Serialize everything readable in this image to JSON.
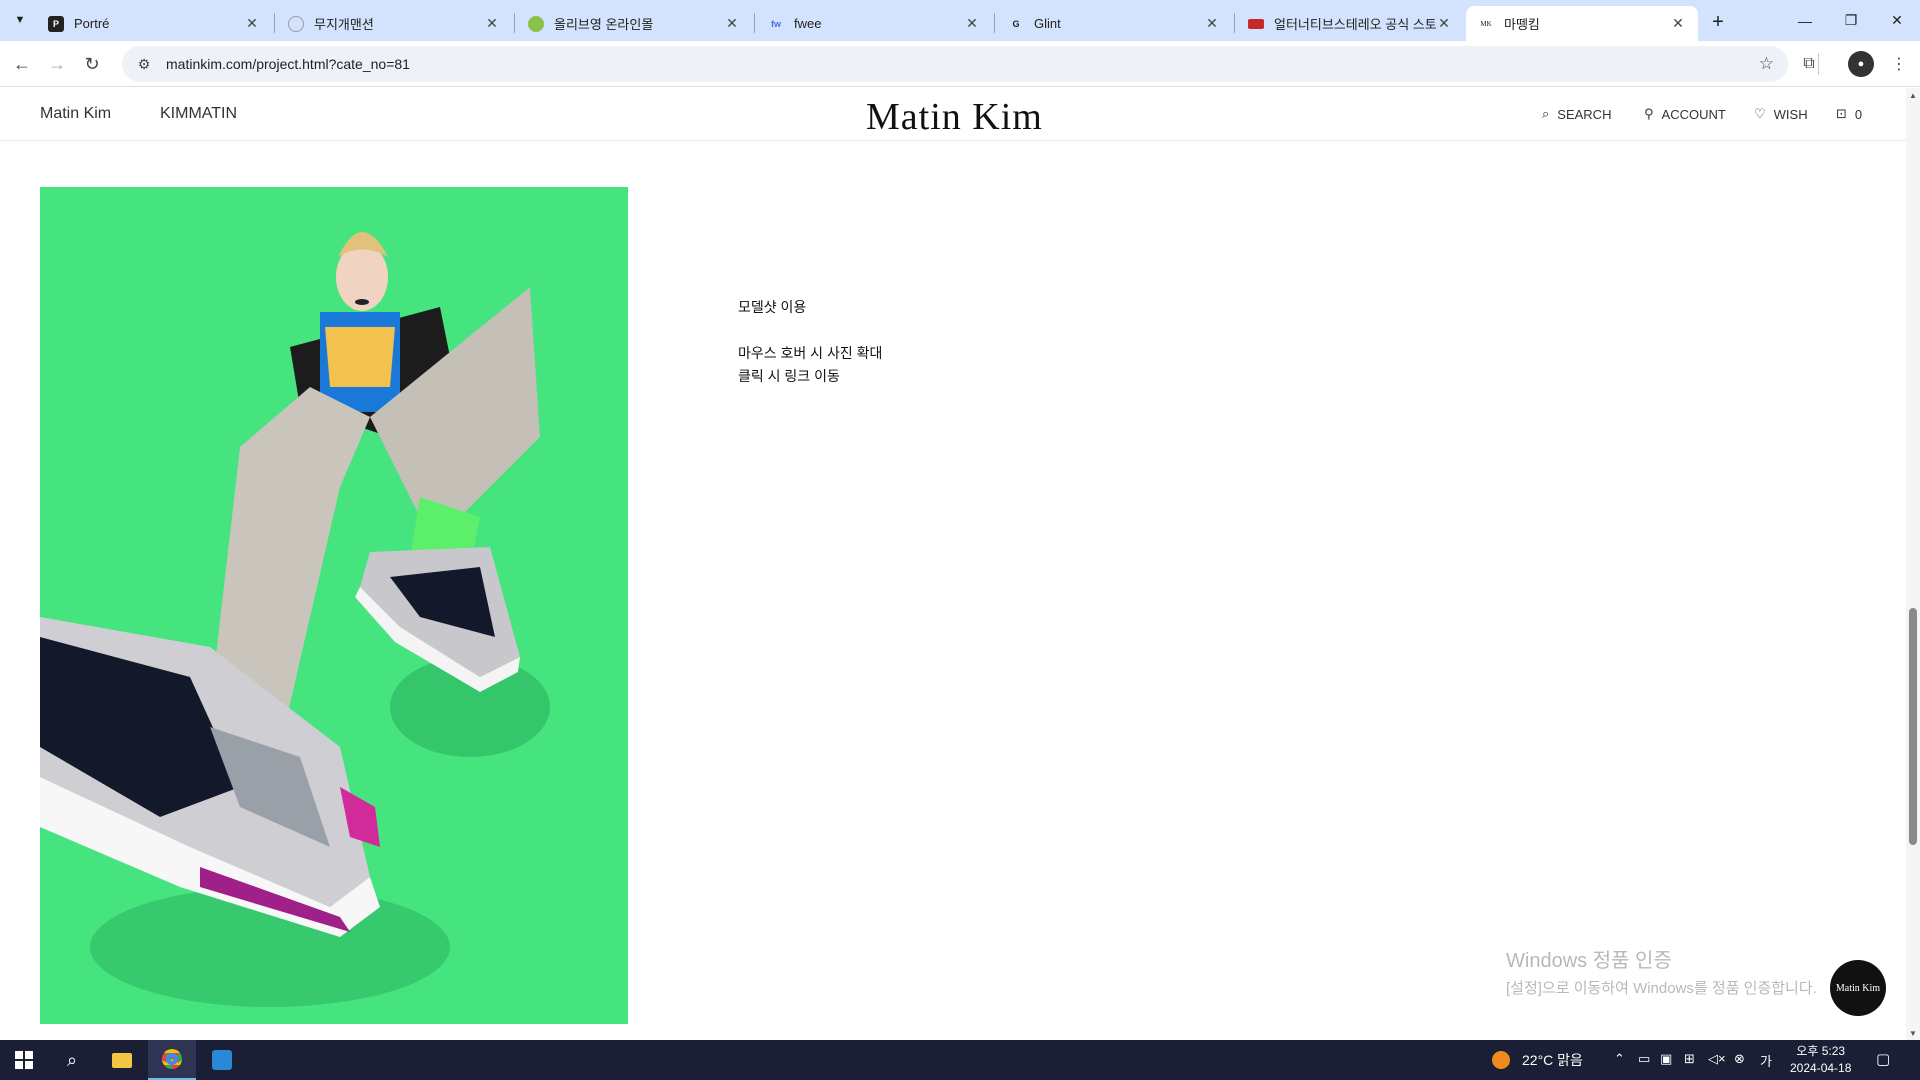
{
  "browser": {
    "tabs": [
      {
        "title": "Portré",
        "favicon": "P",
        "favicon_color": "#222222",
        "active": false
      },
      {
        "title": "무지개맨션",
        "favicon": "○",
        "favicon_color": "#9aa0a6",
        "active": false
      },
      {
        "title": "올리브영 온라인몰",
        "favicon": "O",
        "favicon_color": "#8bc34a",
        "active": false
      },
      {
        "title": "fwee",
        "favicon": "fw",
        "favicon_color": "#4a6ee0",
        "active": false
      },
      {
        "title": "Glint",
        "favicon": "G",
        "favicon_color": "#222222",
        "active": false
      },
      {
        "title": "얼터너티브스테레오 공식 스토",
        "favicon": "▬",
        "favicon_color": "#c62828",
        "active": false
      },
      {
        "title": "마뗑킴",
        "favicon": "MK",
        "favicon_color": "#222222",
        "active": true
      }
    ],
    "url": "matinkim.com/project.html?cate_no=81"
  },
  "site": {
    "nav_left": [
      "Matin Kim",
      "KIMMATIN"
    ],
    "logo": "Matin Kim",
    "nav_right": [
      {
        "label": "SEARCH",
        "icon": "search-icon"
      },
      {
        "label": "ACCOUNT",
        "icon": "account-icon"
      },
      {
        "label": "WISH",
        "icon": "heart-icon"
      },
      {
        "label": "0",
        "icon": "bag-icon"
      }
    ],
    "description": [
      "모델샷 이용",
      "",
      "마우스 호버 시 사진 확대",
      "클릭 시 링크 이동"
    ],
    "float_badge": "Matin Kim"
  },
  "watermark": {
    "title": "Windows 정품 인증",
    "subtitle": "[설정]으로 이동하여 Windows를 정품 인증합니다."
  },
  "taskbar": {
    "weather": "22°C  맑음",
    "time": "오후 5:23",
    "date": "2024-04-18"
  },
  "colors": {
    "tabstrip": "#d3e3fd",
    "photo_bg": "#45e47f",
    "taskbar": "#1a1f36"
  }
}
